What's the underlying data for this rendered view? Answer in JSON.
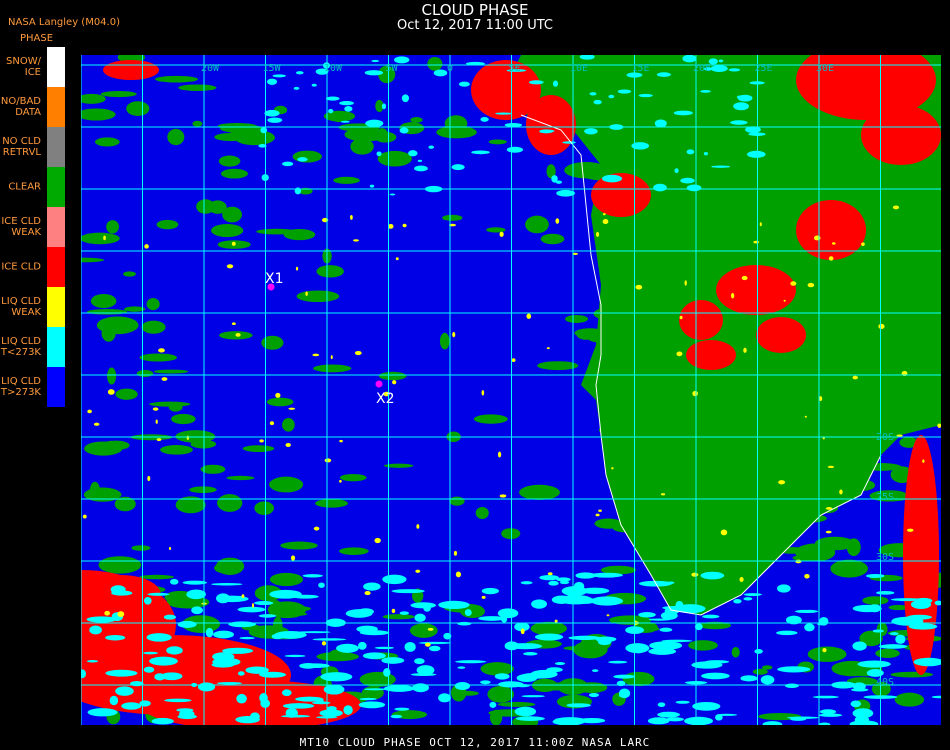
{
  "header": {
    "title": "CLOUD PHASE",
    "subtitle": "Oct 12, 2017 11:00 UTC",
    "producer": "NASA Langley (M04.0)"
  },
  "legend": {
    "title": "PHASE",
    "items": [
      {
        "label": "SNOW/\nICE",
        "color": "#ffffff"
      },
      {
        "label": "NO/BAD\nDATA",
        "color": "#ff8000"
      },
      {
        "label": "NO CLD\nRETRVL",
        "color": "#808080"
      },
      {
        "label": "CLEAR",
        "color": "#00aa00"
      },
      {
        "label": "ICE CLD\nWEAK",
        "color": "#ff8080"
      },
      {
        "label": "ICE CLD",
        "color": "#ff0000"
      },
      {
        "label": "LIQ CLD\nWEAK",
        "color": "#ffff00"
      },
      {
        "label": "LIQ CLD\nT<273K",
        "color": "#00ffff"
      },
      {
        "label": "LIQ CLD\nT>273K",
        "color": "#0000ff"
      }
    ]
  },
  "map": {
    "longitude_labels": [
      "20W",
      "15W",
      "10W",
      "5W",
      "0",
      "5E",
      "10E",
      "15E",
      "20E",
      "25E",
      "30E"
    ],
    "latitude_labels": [
      "20S",
      "25S",
      "30S",
      "40S"
    ],
    "markers": [
      {
        "label": "X1",
        "color": "#ff00ff"
      },
      {
        "label": "X2",
        "color": "#ff00ff"
      }
    ],
    "colors": {
      "ocean_liquid": "#0000e6",
      "clear": "#00a000",
      "ice": "#ff0000",
      "cold_liquid": "#00ffff",
      "weak_liquid": "#ffff00",
      "grid": "#00ffff",
      "coast": "#ffffff"
    }
  },
  "footer": {
    "text": "MT10   CLOUD PHASE   OCT 12, 2017 11:00Z   NASA LARC"
  }
}
